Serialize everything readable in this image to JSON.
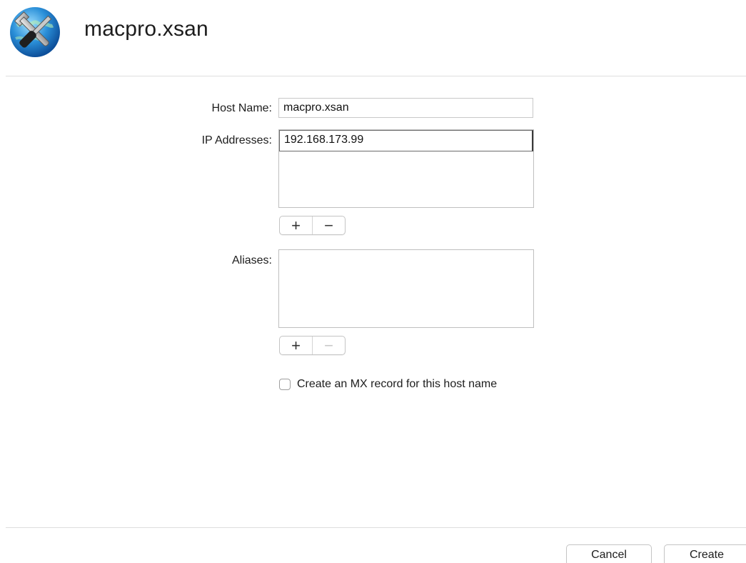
{
  "header": {
    "title": "macpro.xsan",
    "icon": "network-utility-icon"
  },
  "form": {
    "host_name_label": "Host Name:",
    "host_name_value": "macpro.xsan",
    "ip_addresses_label": "IP Addresses:",
    "ip_addresses": [
      "192.168.173.99"
    ],
    "aliases_label": "Aliases:",
    "aliases": [],
    "add_symbol": "+",
    "remove_symbol": "−",
    "mx_checkbox_label": "Create an MX record for this host name",
    "mx_checked": false
  },
  "footer": {
    "cancel_label": "Cancel",
    "create_label": "Create"
  },
  "colors": {
    "divider": "#dedede",
    "border": "#c4c4c4",
    "text": "#1d1d1d",
    "disabled": "#c7c7c7"
  }
}
